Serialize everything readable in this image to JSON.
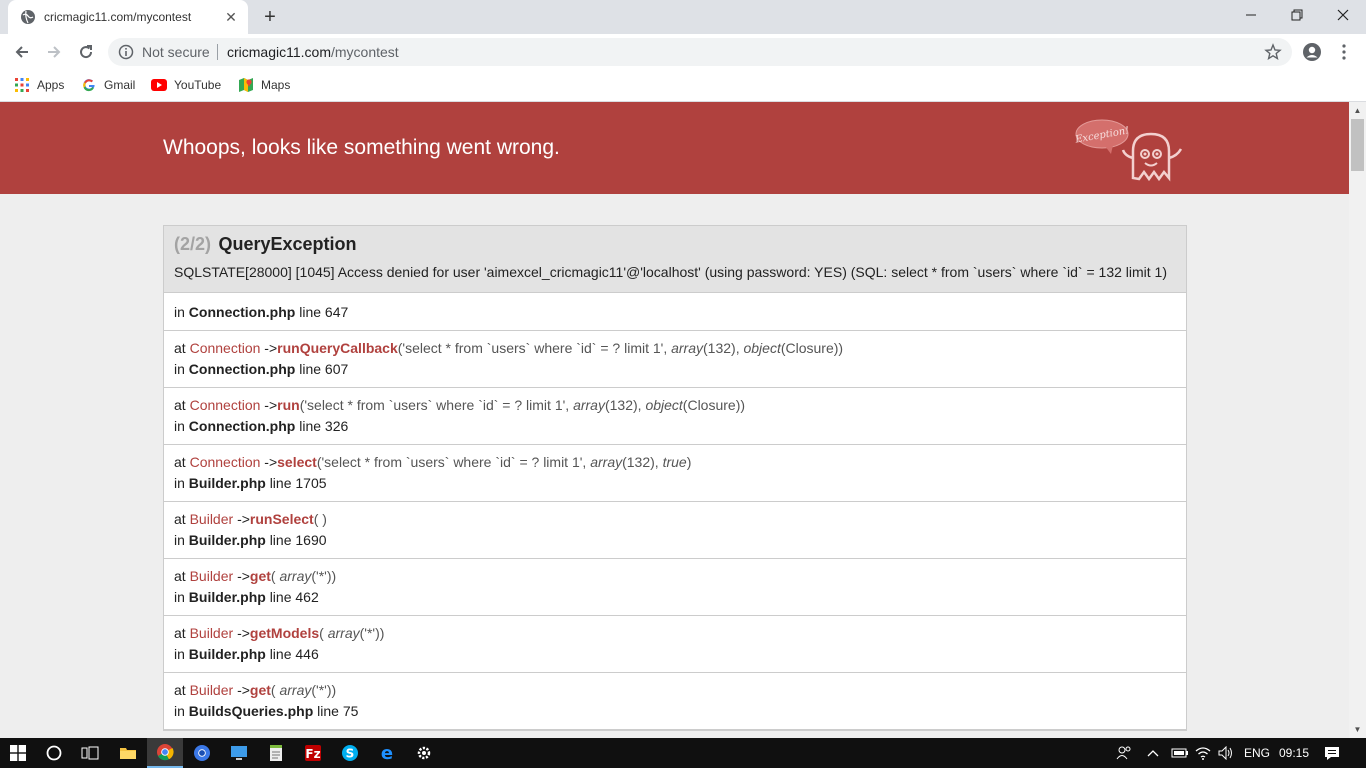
{
  "browser": {
    "tab_title": "cricmagic11.com/mycontest",
    "new_tab": "+",
    "security_label": "Not secure",
    "url_host": "cricmagic11.com",
    "url_path": "/mycontest",
    "bookmarks": [
      "Apps",
      "Gmail",
      "YouTube",
      "Maps"
    ]
  },
  "page": {
    "header_title": "Whoops, looks like something went wrong.",
    "logo_text": "Exception!",
    "exception": {
      "counter": "(2/2)",
      "class": "QueryException",
      "message": "SQLSTATE[28000] [1045] Access denied for user 'aimexcel_cricmagic11'@'localhost' (using password: YES) (SQL: select * from `users` where `id` = 132 limit 1)"
    },
    "first_frame": {
      "in": "in",
      "file": "Connection.php",
      "line": "line 647"
    },
    "frames": [
      {
        "at": "at",
        "class": "Connection",
        "arrow": "->",
        "fn": "runQueryCallback",
        "args_before": "('select * from `users` where `id` = ? limit 1', ",
        "arr": "array",
        "arr_val": "(132), ",
        "obj": "object",
        "obj_val": "(Closure))",
        "in": "in",
        "file": "Connection.php",
        "line": "line 607"
      },
      {
        "at": "at",
        "class": "Connection",
        "arrow": "->",
        "fn": "run",
        "args_before": "('select * from `users` where `id` = ? limit 1', ",
        "arr": "array",
        "arr_val": "(132), ",
        "obj": "object",
        "obj_val": "(Closure))",
        "in": "in",
        "file": "Connection.php",
        "line": "line 326"
      },
      {
        "at": "at",
        "class": "Connection",
        "arrow": "->",
        "fn": "select",
        "args_before": "('select * from `users` where `id` = ? limit 1', ",
        "arr": "array",
        "arr_val": "(132), ",
        "obj": "true",
        "obj_val": ")",
        "in": "in",
        "file": "Builder.php",
        "line": "line 1705"
      },
      {
        "at": "at",
        "class": "Builder",
        "arrow": "->",
        "fn": "runSelect",
        "args_before": "( )",
        "arr": "",
        "arr_val": "",
        "obj": "",
        "obj_val": "",
        "in": "in",
        "file": "Builder.php",
        "line": "line 1690"
      },
      {
        "at": "at",
        "class": "Builder",
        "arrow": "->",
        "fn": "get",
        "args_before": "( ",
        "arr": "array",
        "arr_val": "('*'))",
        "obj": "",
        "obj_val": "",
        "in": "in",
        "file": "Builder.php",
        "line": "line 462"
      },
      {
        "at": "at",
        "class": "Builder",
        "arrow": "->",
        "fn": "getModels",
        "args_before": "( ",
        "arr": "array",
        "arr_val": "('*'))",
        "obj": "",
        "obj_val": "",
        "in": "in",
        "file": "Builder.php",
        "line": "line 446"
      },
      {
        "at": "at",
        "class": "Builder",
        "arrow": "->",
        "fn": "get",
        "args_before": "( ",
        "arr": "array",
        "arr_val": "('*'))",
        "obj": "",
        "obj_val": "",
        "in": "in",
        "file": "BuildsQueries.php",
        "line": "line 75"
      }
    ]
  },
  "taskbar": {
    "language": "ENG",
    "time": "09:15"
  },
  "colors": {
    "header_bg": "#b0413e",
    "accent": "#b0413e"
  }
}
